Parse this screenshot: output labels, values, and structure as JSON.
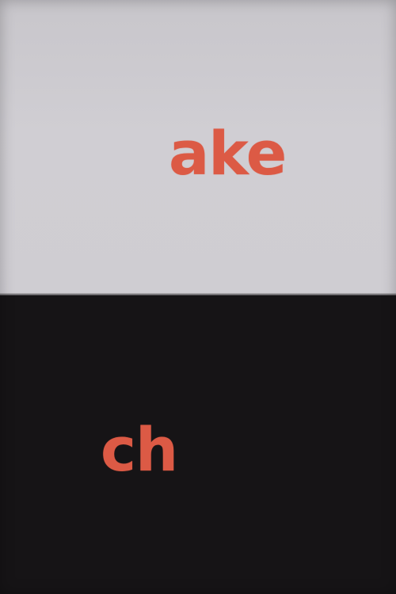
{
  "top_panel": {
    "word": "ake",
    "background_color": "#cfcdd2",
    "text_color": "#dc5a45"
  },
  "bottom_panel": {
    "word": "ch",
    "background_color": "#161416",
    "text_color": "#dc5a45"
  }
}
